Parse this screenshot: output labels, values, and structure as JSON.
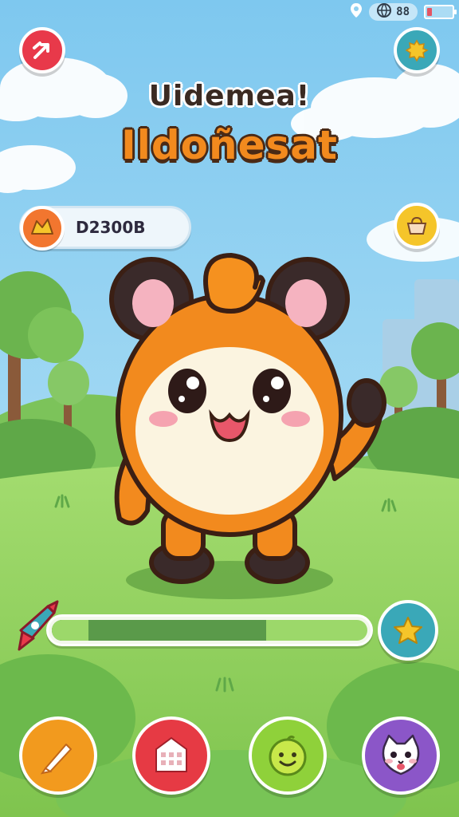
{
  "status_bar": {
    "time_text": "88",
    "battery_level": 0.2,
    "location_icon": "location-pin-icon",
    "globe_icon": "globe-icon"
  },
  "top_left_button": {
    "icon": "arrows-swap-icon",
    "color": "#e8394a"
  },
  "top_right_button": {
    "icon": "settings-cog-icon",
    "color": "#3aa8b8"
  },
  "title": {
    "line1": "Uidemea!",
    "line2": "Ildoñesat"
  },
  "score": {
    "value": "D2300B",
    "icon": "paw-badge-icon"
  },
  "right_side_button": {
    "icon": "basket-icon",
    "color": "#f5c52a"
  },
  "progress": {
    "level": 0.68,
    "start_icon": "rocket-pin-icon",
    "end_icon": "star-icon"
  },
  "bottom_buttons": [
    {
      "icon": "brush-icon",
      "color": "#f29a1e"
    },
    {
      "icon": "calendar-house-icon",
      "color": "#e63a44"
    },
    {
      "icon": "smiley-face-icon",
      "color": "#8fd13a"
    },
    {
      "icon": "cat-face-icon",
      "color": "#8b56c8"
    }
  ],
  "colors": {
    "sky": "#8fd0f0",
    "grass": "#8fd15a",
    "mascot_orange": "#f28a1e",
    "title_orange": "#f28a1e"
  }
}
